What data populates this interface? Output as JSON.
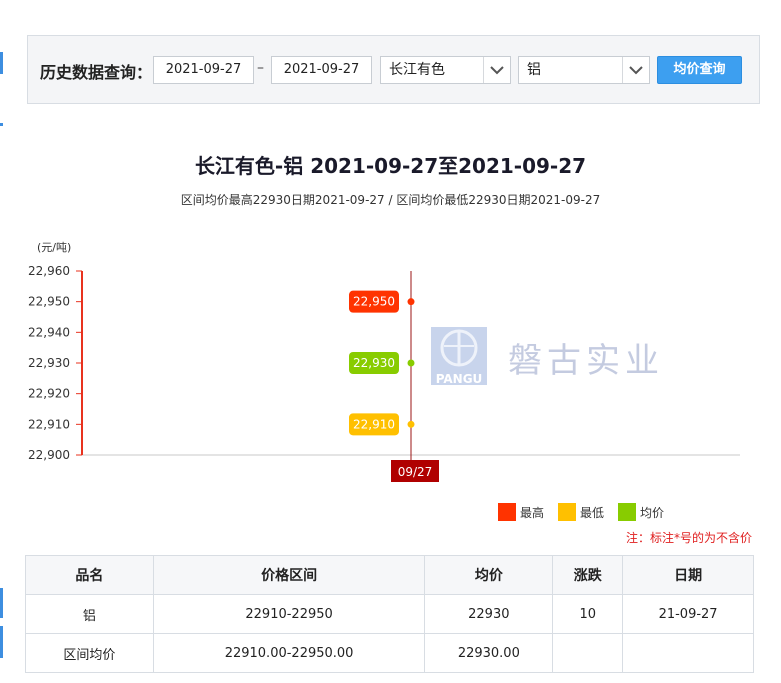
{
  "query": {
    "label": "历史数据查询：",
    "start_date": "2021-09-27",
    "dash": "–",
    "end_date": "2021-09-27",
    "market": "长江有色",
    "metal": "铝",
    "button": "均价查询"
  },
  "title": "长江有色-铝 2021-09-27至2021-09-27",
  "subtitle": "区间均价最高22930日期2021-09-27 / 区间均价最低22930日期2021-09-27",
  "watermark": {
    "brand": "PANGU",
    "text": "磐古实业"
  },
  "legend": [
    {
      "label": "最高",
      "color": "#ff3300"
    },
    {
      "label": "最低",
      "color": "#ffc000"
    },
    {
      "label": "均价",
      "color": "#88cc00"
    }
  ],
  "note": "注：标注*号的为不含价",
  "chart_data": {
    "type": "line",
    "ylabel": "(元/吨)",
    "ylim": [
      22900,
      22960
    ],
    "yticks": [
      "22,960",
      "22,950",
      "22,940",
      "22,930",
      "22,920",
      "22,910",
      "22,900"
    ],
    "categories": [
      "09/27"
    ],
    "series": [
      {
        "name": "最高",
        "values": [
          22950
        ],
        "label": "22,950",
        "color": "#ff3300"
      },
      {
        "name": "均价",
        "values": [
          22930
        ],
        "label": "22,930",
        "color": "#88cc00"
      },
      {
        "name": "最低",
        "values": [
          22910
        ],
        "label": "22,910",
        "color": "#ffc000"
      }
    ]
  },
  "table": {
    "headers": [
      "品名",
      "价格区间",
      "均价",
      "涨跌",
      "日期"
    ],
    "rows": [
      [
        "铝",
        "22910-22950",
        "22930",
        "10",
        "21-09-27"
      ],
      [
        "区间均价",
        "22910.00-22950.00",
        "22930.00",
        "",
        ""
      ]
    ]
  }
}
